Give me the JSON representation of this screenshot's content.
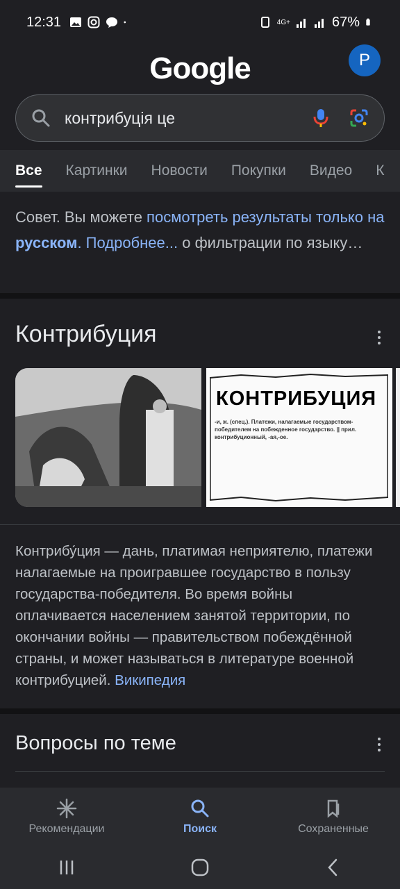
{
  "status": {
    "time": "12:31",
    "battery": "67%",
    "network": "4G+"
  },
  "header": {
    "logo": "Google",
    "avatar_letter": "P"
  },
  "search": {
    "query": "контрибуція це"
  },
  "tabs": [
    {
      "label": "Все"
    },
    {
      "label": "Картинки"
    },
    {
      "label": "Новости"
    },
    {
      "label": "Покупки"
    },
    {
      "label": "Видео"
    },
    {
      "label": "К"
    }
  ],
  "tip": {
    "prefix": "Совет. Вы можете ",
    "link1": "посмотреть результаты только на ",
    "link1_bold": "русском",
    "link2": ". Подробнее...",
    "suffix": " о фильтрации по языку…"
  },
  "knowledge": {
    "title": "Контрибуция",
    "image2_word": "КОНТРИБУЦИЯ",
    "image2_definition": "-и, ж. (спец.). Платежи, налагаемые государством-победителем на побежденное государство. || прил. контрибуционный, -ая,-ое.",
    "description": "Контрибу́ция — дань, платимая неприятелю, платежи налагаемые на проигравшее государство в пользу государства-победителя. Во время войны оплачивается населением занятой территории, по окончании войны — правительством побеждённой страны, и может называться в литературе военной контрибуцией. ",
    "source": "Википедия"
  },
  "related": {
    "title": "Вопросы по теме"
  },
  "bottom_nav": [
    {
      "label": "Рекомендации"
    },
    {
      "label": "Поиск"
    },
    {
      "label": "Сохраненные"
    }
  ]
}
